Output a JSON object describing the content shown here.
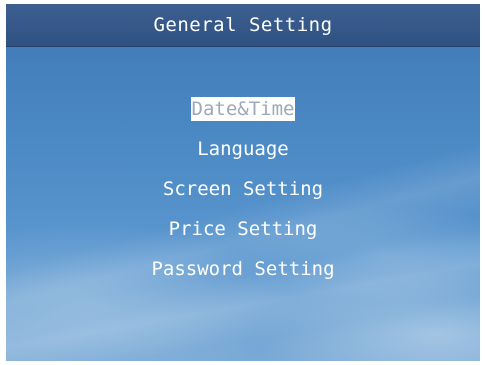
{
  "header": {
    "title": "General Setting"
  },
  "menu": {
    "items": [
      {
        "label": "Date&Time"
      },
      {
        "label": "Language"
      },
      {
        "label": "Screen Setting"
      },
      {
        "label": "Price Setting"
      },
      {
        "label": "Password Setting"
      }
    ],
    "selected_index": 0
  },
  "colors": {
    "background_sky": "#4a88c4",
    "title_bar": "#3c5f90",
    "text": "#ffffff",
    "selection_highlight": "#ffffff",
    "selected_text": "#9aa9bc"
  }
}
